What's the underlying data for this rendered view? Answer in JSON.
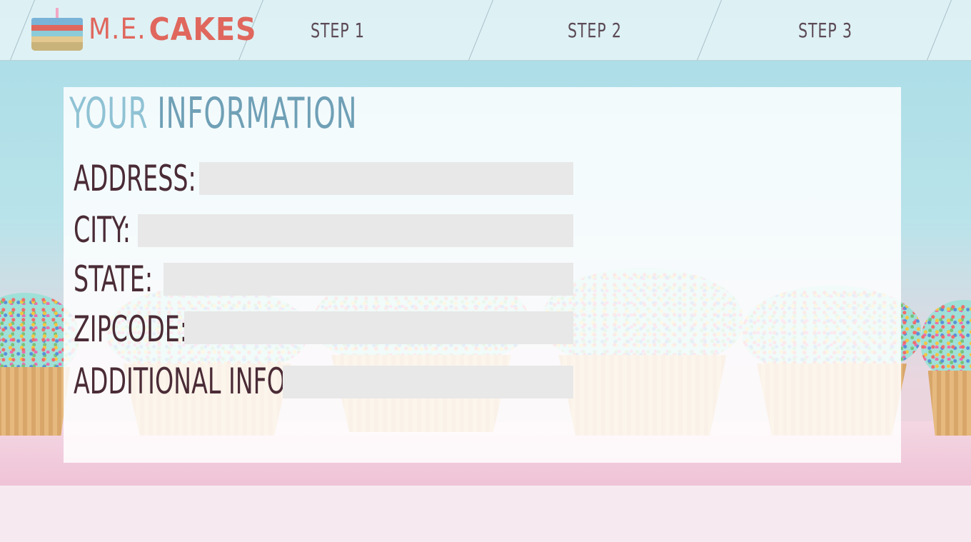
{
  "brand": {
    "prefix": "M.E.",
    "name": "CAKES"
  },
  "nav": {
    "steps": [
      {
        "label": "Step 1"
      },
      {
        "label": "Step 2"
      },
      {
        "label": "Step 3"
      }
    ]
  },
  "form": {
    "title_light": "Your",
    "title_bold": "Information",
    "fields": [
      {
        "label": "Address:",
        "value": ""
      },
      {
        "label": "City:",
        "value": ""
      },
      {
        "label": "State:",
        "value": ""
      },
      {
        "label": "Zipcode:",
        "value": ""
      },
      {
        "label": "Additional Info:",
        "value": ""
      }
    ]
  },
  "colors": {
    "brand": "#e0675d",
    "title_light": "#8fc2d4",
    "title_bold": "#6fa0b6",
    "label_text": "#4a2b36",
    "nav_text": "#5b4a55",
    "field_bg": "#e8e8e8"
  },
  "icons": {
    "logo": "layered-cake-icon"
  }
}
